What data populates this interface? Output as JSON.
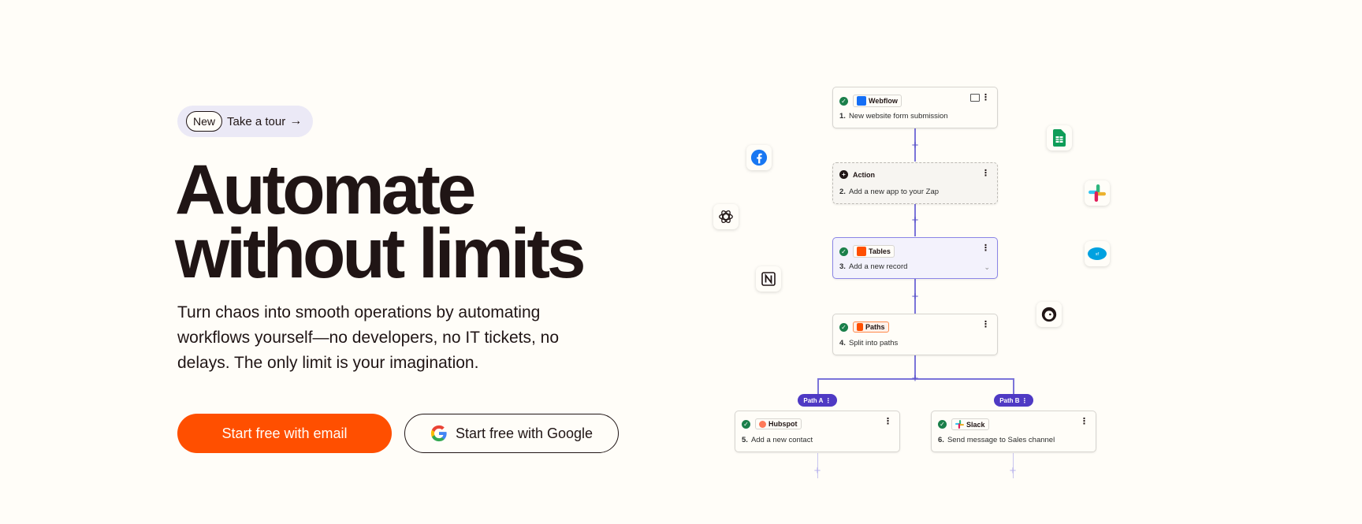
{
  "hero": {
    "badge_new": "New",
    "badge_tour": "Take a tour",
    "title_line1": "Automate",
    "title_line2": "without limits",
    "subtitle": "Turn chaos into smooth operations by automating workflows yourself—no developers, no IT tickets, no delays. The only limit is your imagination.",
    "cta_email": "Start free with email",
    "cta_google": "Start free with Google"
  },
  "workflow": {
    "steps": [
      {
        "app": "Webflow",
        "num": "1.",
        "text": "New website form submission"
      },
      {
        "app": "Action",
        "num": "2.",
        "text": "Add a new app to your Zap"
      },
      {
        "app": "Tables",
        "num": "3.",
        "text": "Add a new record"
      },
      {
        "app": "Paths",
        "num": "4.",
        "text": "Split into paths"
      },
      {
        "app": "Hubspot",
        "num": "5.",
        "text": "Add a new contact"
      },
      {
        "app": "Slack",
        "num": "6.",
        "text": "Send message to Sales channel"
      }
    ],
    "path_a": "Path A",
    "path_b": "Path B"
  },
  "colors": {
    "accent": "#ff4f00",
    "background": "#fffdf8",
    "path_tag": "#4f3ac4",
    "connector": "#7b74d9"
  },
  "floating_icons": [
    "facebook-icon",
    "openai-icon",
    "notion-icon",
    "google-sheets-icon",
    "slack-icon",
    "salesforce-icon",
    "mailchimp-icon"
  ]
}
